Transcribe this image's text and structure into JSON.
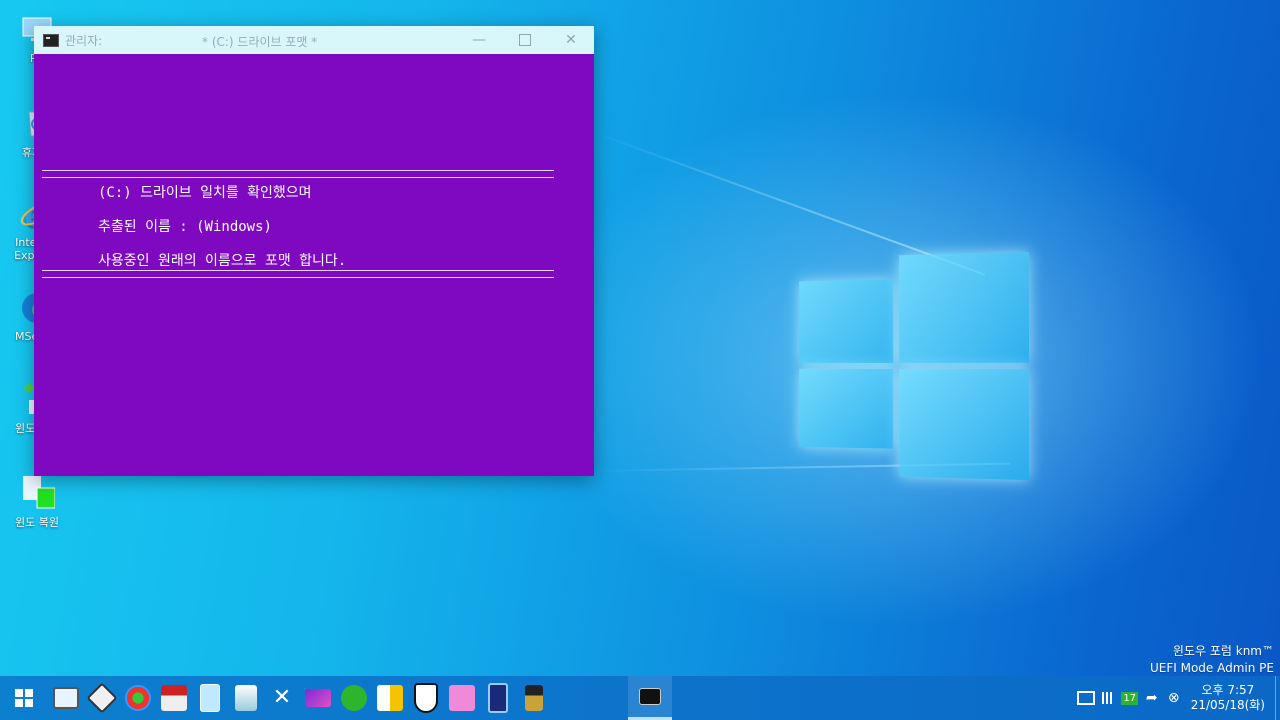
{
  "desktop": {
    "icons": [
      {
        "label": "PC",
        "icon": "computer-icon"
      },
      {
        "label": "휴지통",
        "icon": "recycle-bin-icon"
      },
      {
        "label": "Internet Explorer",
        "icon": "internet-explorer-icon"
      },
      {
        "label": "MSedge",
        "icon": "edge-icon"
      },
      {
        "label": "윈도 백업",
        "icon": "backup-icon"
      },
      {
        "label": "윈도 복원",
        "icon": "restore-icon"
      }
    ]
  },
  "console": {
    "title_prefix": "관리자:",
    "title": "* (C:) 드라이브 포맷 *",
    "separator": "==================================================================",
    "lines": [
      "(C:) 드라이브 일치를 확인했으며",
      "추출된 이름 : (Windows)",
      "사용중인 원래의 이름으로 포맷 합니다."
    ],
    "background_color": "#7f08c1"
  },
  "watermark": {
    "line1": "윈도우 포럼 knm™",
    "line2": "UEFI Mode Admin PE"
  },
  "taskbar": {
    "pinned": [
      "start-icon",
      "task-manager-icon",
      "disk-tool-icon",
      "partition-icon",
      "drive-icon",
      "folder-icon",
      "network-icon",
      "tools-icon",
      "media-icon",
      "sync-icon",
      "explorer-icon",
      "security-icon",
      "store-icon",
      "phone-icon",
      "archive-icon",
      "console-icon"
    ],
    "clock": {
      "time": "오후 7:57",
      "date": "21/05/18(화)"
    },
    "tray_badge": "17"
  }
}
